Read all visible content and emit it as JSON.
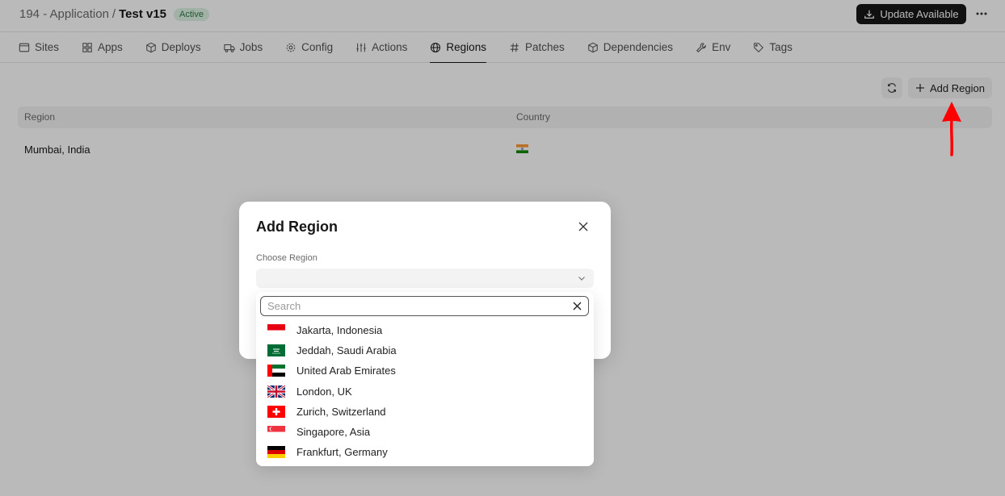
{
  "header": {
    "crumb_parent": "194 - Application",
    "crumb_separator": "/",
    "crumb_current": "Test v15",
    "status_badge": "Active",
    "update_button": "Update Available",
    "more_icon": "more-horizontal-icon"
  },
  "tabs": [
    {
      "label": "Sites",
      "icon": "browser-icon",
      "active": false
    },
    {
      "label": "Apps",
      "icon": "grid-icon",
      "active": false
    },
    {
      "label": "Deploys",
      "icon": "package-icon",
      "active": false
    },
    {
      "label": "Jobs",
      "icon": "truck-icon",
      "active": false
    },
    {
      "label": "Config",
      "icon": "gear-icon",
      "active": false
    },
    {
      "label": "Actions",
      "icon": "sliders-icon",
      "active": false
    },
    {
      "label": "Regions",
      "icon": "globe-icon",
      "active": true
    },
    {
      "label": "Patches",
      "icon": "hash-icon",
      "active": false
    },
    {
      "label": "Dependencies",
      "icon": "package-icon",
      "active": false
    },
    {
      "label": "Env",
      "icon": "wrench-icon",
      "active": false
    },
    {
      "label": "Tags",
      "icon": "tag-icon",
      "active": false
    }
  ],
  "toolbar": {
    "refresh_icon": "refresh-icon",
    "add_region_label": "Add Region"
  },
  "table": {
    "columns": [
      "Region",
      "Country"
    ],
    "rows": [
      {
        "region": "Mumbai, India",
        "country_flag": "india-flag"
      }
    ]
  },
  "dialog": {
    "title": "Add Region",
    "field_label": "Choose Region",
    "selected_value": "",
    "search_placeholder": "Search",
    "options": [
      {
        "label": "Jakarta, Indonesia",
        "flag": "indonesia-flag"
      },
      {
        "label": "Jeddah, Saudi Arabia",
        "flag": "saudi-arabia-flag"
      },
      {
        "label": "United Arab Emirates",
        "flag": "uae-flag"
      },
      {
        "label": "London, UK",
        "flag": "uk-flag"
      },
      {
        "label": "Zurich, Switzerland",
        "flag": "switzerland-flag"
      },
      {
        "label": "Singapore, Asia",
        "flag": "singapore-flag"
      },
      {
        "label": "Frankfurt, Germany",
        "flag": "germany-flag"
      }
    ]
  },
  "colors": {
    "accent_dark": "#171717",
    "badge_bg": "#dff3e4",
    "badge_text": "#2d7a46",
    "annotation_arrow": "#ff0000"
  }
}
